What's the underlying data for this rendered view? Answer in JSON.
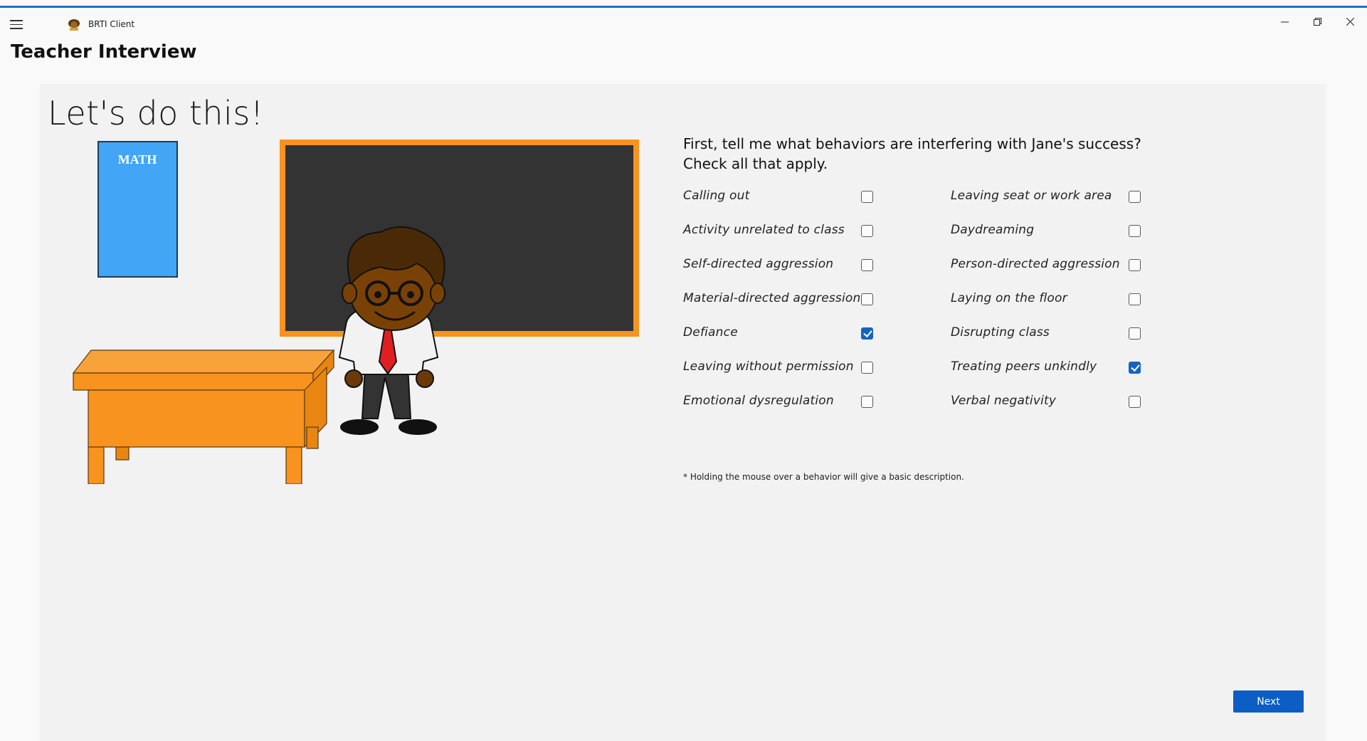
{
  "window": {
    "app_name": "BRTI Client",
    "controls": [
      "minimize-icon",
      "restore-icon",
      "close-icon"
    ]
  },
  "page": {
    "title": "Teacher Interview",
    "hero": "Let's do this!",
    "question_line1": "First, tell me what behaviors are interfering with Jane's success?",
    "question_line2": "Check all that apply.",
    "note": "* Holding the mouse over a behavior will give a basic description.",
    "next_label": "Next"
  },
  "illustration": {
    "book_label": "MATH"
  },
  "behaviors": {
    "left": [
      {
        "label": "Calling out",
        "checked": false
      },
      {
        "label": "Activity unrelated to class",
        "checked": false
      },
      {
        "label": "Self-directed aggression",
        "checked": false
      },
      {
        "label": "Material-directed aggression",
        "checked": false
      },
      {
        "label": "Defiance",
        "checked": true
      },
      {
        "label": "Leaving without permission",
        "checked": false
      },
      {
        "label": "Emotional dysregulation",
        "checked": false
      }
    ],
    "right": [
      {
        "label": "Leaving seat or work area",
        "checked": false
      },
      {
        "label": "Daydreaming",
        "checked": false
      },
      {
        "label": "Person-directed aggression",
        "checked": false
      },
      {
        "label": "Laying on the floor",
        "checked": false
      },
      {
        "label": "Disrupting class",
        "checked": false
      },
      {
        "label": "Treating peers unkindly",
        "checked": true
      },
      {
        "label": "Verbal negativity",
        "checked": false
      }
    ]
  },
  "colors": {
    "accent": "#1f6fc4",
    "button": "#0c5ec4",
    "chalkboard": "#333333",
    "chalkboard_frame": "#f7931e",
    "desk": "#f7931e",
    "book": "#42a5f5"
  }
}
